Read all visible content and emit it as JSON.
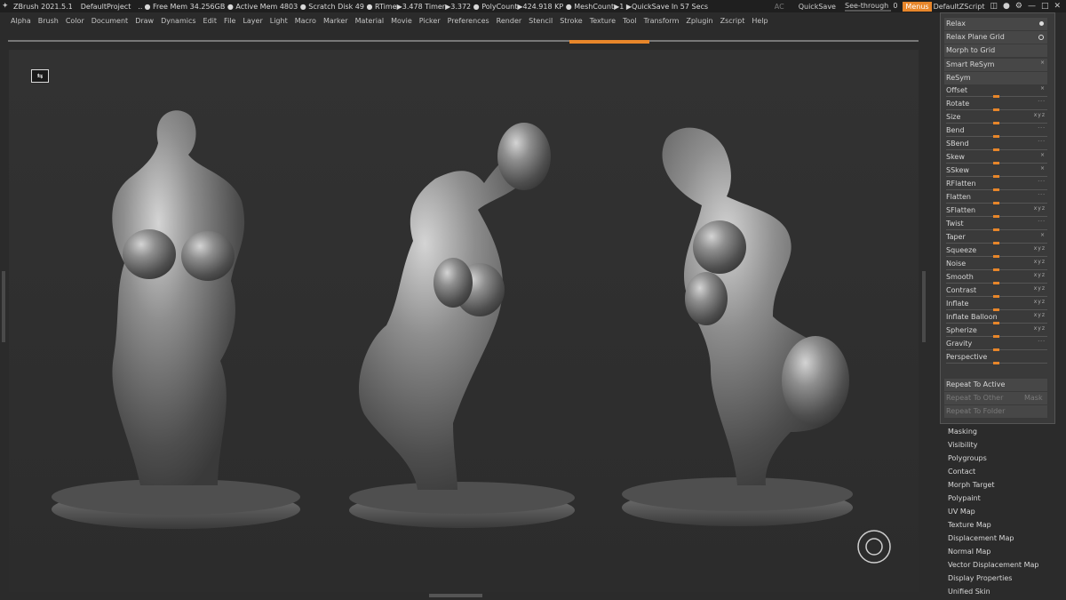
{
  "titlebar": {
    "app": "ZBrush 2021.5.1",
    "project": "DefaultProject",
    "dots": "..",
    "stats": "● Free Mem 34.256GB ● Active Mem 4803 ● Scratch Disk 49 ●  RTime▶3.478 Timer▶3.372 ● PolyCount▶424.918 KP ● MeshCount▶1  ▶QuickSave In 57 Secs",
    "ac": "AC",
    "quicksave": "QuickSave",
    "seethrough_label": "See-through",
    "seethrough_value": "0",
    "menus": "Menus",
    "script": "DefaultZScript"
  },
  "menubar": [
    "Alpha",
    "Brush",
    "Color",
    "Document",
    "Draw",
    "Dynamics",
    "Edit",
    "File",
    "Layer",
    "Light",
    "Macro",
    "Marker",
    "Material",
    "Movie",
    "Picker",
    "Preferences",
    "Render",
    "Stencil",
    "Stroke",
    "Texture",
    "Tool",
    "Transform",
    "Zplugin",
    "Zscript",
    "Help"
  ],
  "deformation": {
    "relax": "Relax",
    "relax_plane_grid": "Relax Plane Grid",
    "morph_to_grid": "Morph to Grid",
    "smart_resym": "Smart ReSym",
    "resym": "ReSym",
    "sliders": [
      "Offset",
      "Rotate",
      "Size",
      "Bend",
      "SBend",
      "Skew",
      "SSkew",
      "RFlatten",
      "Flatten",
      "SFlatten",
      "Twist",
      "Taper",
      "Squeeze",
      "Noise",
      "Smooth",
      "Contrast",
      "Inflate",
      "Inflate Balloon",
      "Spherize",
      "Gravity",
      "Perspective"
    ],
    "repeat_to_active": "Repeat To Active",
    "repeat_to_other": "Repeat To Other",
    "mask": "Mask",
    "repeat_to_folder": "Repeat To Folder"
  },
  "sections": [
    "Masking",
    "Visibility",
    "Polygroups",
    "Contact",
    "Morph Target",
    "Polypaint",
    "UV Map",
    "Texture Map",
    "Displacement Map",
    "Normal Map",
    "Vector Displacement Map",
    "Display Properties",
    "Unified Skin"
  ],
  "viewport": {
    "icon": "view-toggle-icon",
    "gizmo": "rotate-gizmo-icon",
    "models": 3
  },
  "colors": {
    "accent": "#e8862a",
    "panel": "#3a3a3a",
    "viewport": "#2f2f2f",
    "model": "#8c8c8c"
  }
}
